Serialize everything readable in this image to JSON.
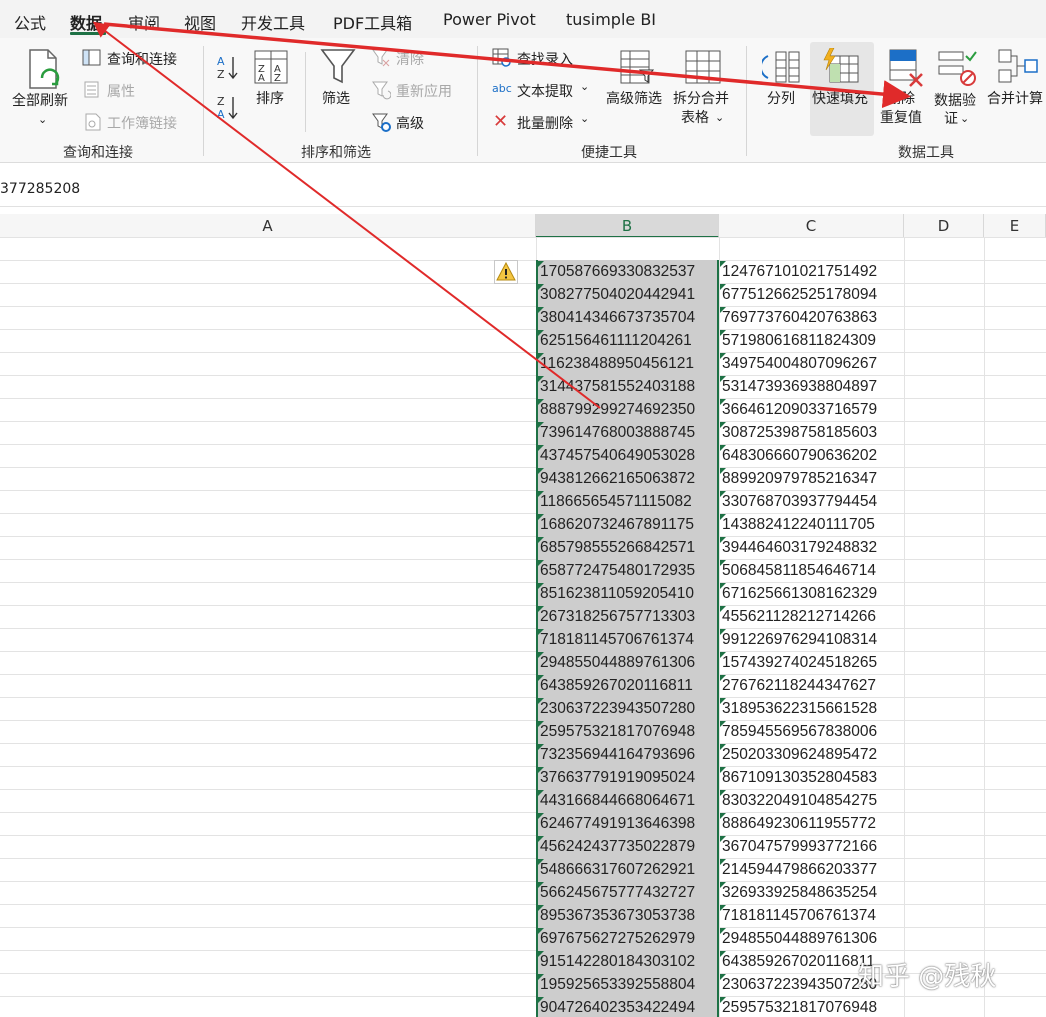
{
  "tabs": [
    "公式",
    "数据",
    "审阅",
    "视图",
    "开发工具",
    "PDF工具箱",
    "Power Pivot",
    "tusimple BI"
  ],
  "ribbon": {
    "refresh_all": "全部刷新",
    "query_connections": "查询和连接",
    "properties": "属性",
    "workbook_links": "工作簿链接",
    "group_query": "查询和连接",
    "sort": "排序",
    "filter": "筛选",
    "clear": "清除",
    "reapply": "重新应用",
    "advanced": "高级",
    "group_sort": "排序和筛选",
    "find_enter": "查找录入",
    "text_extract": "文本提取",
    "batch_delete": "批量删除",
    "advanced_filter": "高级筛选",
    "split_merge_line1": "拆分合并",
    "split_merge_line2": "表格",
    "group_convenient": "便捷工具",
    "text_to_columns": "分列",
    "flash_fill": "快速填充",
    "remove_dup_line1": "删除",
    "remove_dup_line2": "重复值",
    "data_validation_line1": "数据验",
    "data_validation_line2": "证",
    "consolidate": "合并计算",
    "group_data_tools": "数据工具"
  },
  "formula_bar": {
    "value": "377285208"
  },
  "columns": [
    "A",
    "B",
    "C",
    "D",
    "E"
  ],
  "rows": [
    [
      "170587669330832537",
      "124767101021751492"
    ],
    [
      "308277504020442941",
      "677512662525178094"
    ],
    [
      "380414346673735704",
      "769773760420763863"
    ],
    [
      "625156461111204261",
      "571980616811824309"
    ],
    [
      "116238488950456121",
      "349754004807096267"
    ],
    [
      "314437581552403188",
      "531473936938804897"
    ],
    [
      "888799299274692350",
      "366461209033716579"
    ],
    [
      "739614768003888745",
      "308725398758185603"
    ],
    [
      "437457540649053028",
      "648306660790636202"
    ],
    [
      "943812662165063872",
      "889920979785216347"
    ],
    [
      "118665654571115082",
      "330768703937794454"
    ],
    [
      "168620732467891175",
      "143882412240111705"
    ],
    [
      "685798555266842571",
      "394464603179248832"
    ],
    [
      "658772475480172935",
      "506845811854646714"
    ],
    [
      "851623811059205410",
      "671625661308162329"
    ],
    [
      "267318256757713303",
      "455621128212714266"
    ],
    [
      "718181145706761374",
      "991226976294108314"
    ],
    [
      "294855044889761306",
      "157439274024518265"
    ],
    [
      "643859267020116811",
      "276762118244347627"
    ],
    [
      "230637223943507280",
      "318953622315661528"
    ],
    [
      "259575321817076948",
      "785945569567838006"
    ],
    [
      "732356944164793696",
      "250203309624895472"
    ],
    [
      "376637791919095024",
      "867109130352804583"
    ],
    [
      "443166844668064671",
      "830322049104854275"
    ],
    [
      "624677491913646398",
      "888649230611955772"
    ],
    [
      "456242437735022879",
      "367047579993772166"
    ],
    [
      "548666317607262921",
      "214594479866203377"
    ],
    [
      "566245675777432727",
      "326933925848635254"
    ],
    [
      "895367353673053738",
      "718181145706761374"
    ],
    [
      "697675627275262979",
      "294855044889761306"
    ],
    [
      "915142280184303102",
      "643859267020116811"
    ],
    [
      "195925653392558804",
      "230637223943507280"
    ],
    [
      "904726402353422494",
      "259575321817076948"
    ]
  ],
  "watermark": "知乎 @残秋",
  "colors": {
    "accent": "#1e7145",
    "arrow": "#e02a2a",
    "selection": "#cdcdcd"
  }
}
